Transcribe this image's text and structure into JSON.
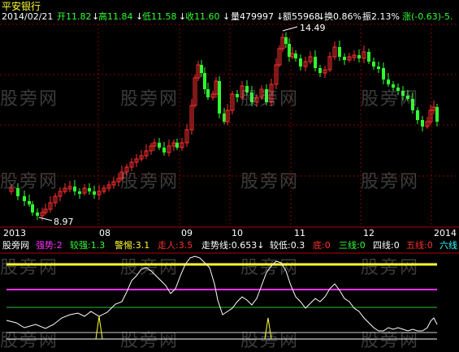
{
  "title": "平安银行",
  "colors": {
    "up": "#ff3030",
    "down": "#30ff30",
    "grid": "#8a0000",
    "axis": "#b00000",
    "line_white": "#ffffff",
    "yellow": "#ffff30",
    "magenta": "#ff30ff",
    "green_line": "#30c030"
  },
  "info": {
    "date": "2014/02/21",
    "open": "开11.82",
    "open_arrow": "↓",
    "high": "高11.84",
    "high_arrow": "↓",
    "low": "低11.58",
    "low_arrow": "↓",
    "close": "收11.60",
    "close_arrow": "↓",
    "volume": "量479997",
    "volume_arrow": "↓",
    "amount": "额55968",
    "amount_arrow": "↓",
    "turnover": "换0.86%",
    "amplitude": "振2.13%",
    "change": "涨(-0.63)-5."
  },
  "annotations": {
    "high_mark": "14.49",
    "low_mark": "8.97"
  },
  "x_axis": {
    "labels": [
      "2013",
      "08",
      "09",
      "10",
      "11",
      "12",
      "2014"
    ]
  },
  "indicator": {
    "name": "股旁网",
    "items": [
      {
        "label": "强势:",
        "value": "2",
        "color": "#ff30ff"
      },
      {
        "label": "较强:",
        "value": "1.3",
        "color": "#30ff30"
      },
      {
        "label": "警惕:",
        "value": "3.1",
        "color": "#ffff30"
      },
      {
        "label": "走人:",
        "value": "3.5",
        "color": "#ff3030"
      },
      {
        "label": "走势线:",
        "value": "0.653",
        "arrow": "↓",
        "color": "#ffffff"
      },
      {
        "label": "较低:",
        "value": "0.3",
        "color": "#ffffff"
      },
      {
        "label": "底:",
        "value": "0",
        "color": "#ff3030"
      },
      {
        "label": "三线:",
        "value": "0",
        "color": "#30ff30"
      },
      {
        "label": "四线:",
        "value": "0",
        "color": "#ffffff"
      },
      {
        "label": "五线:",
        "value": "0",
        "color": "#ff3030"
      },
      {
        "label": "六线",
        "value": "",
        "color": "#30ffff"
      }
    ],
    "levels": {
      "strong": 2,
      "fairly_strong": 1.3,
      "warning": 3.1,
      "leave": 3.5,
      "low": 0.3,
      "bottom": 0
    }
  },
  "watermark": "股旁网"
}
